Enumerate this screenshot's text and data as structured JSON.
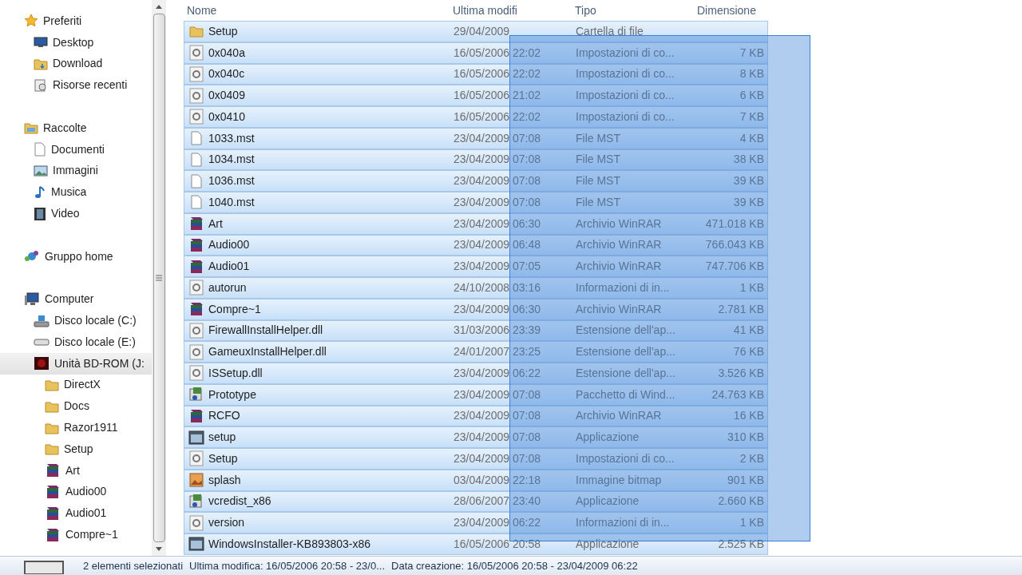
{
  "sidebar": {
    "groups": [
      {
        "label": "Preferiti",
        "kind": "star",
        "children": [
          {
            "label": "Desktop",
            "kind": "desktop",
            "selected": false
          },
          {
            "label": "Download",
            "kind": "download",
            "selected": false
          },
          {
            "label": "Risorse recenti",
            "kind": "recent",
            "selected": false
          }
        ]
      },
      {
        "label": "Raccolte",
        "kind": "library",
        "children": [
          {
            "label": "Documenti",
            "kind": "doc",
            "selected": false
          },
          {
            "label": "Immagini",
            "kind": "image",
            "selected": false
          },
          {
            "label": "Musica",
            "kind": "music",
            "selected": false
          },
          {
            "label": "Video",
            "kind": "video",
            "selected": false
          }
        ]
      },
      {
        "label": "Gruppo home",
        "kind": "homegroup"
      },
      {
        "label": "Computer",
        "kind": "computer",
        "children": [
          {
            "label": "Disco locale (C:)",
            "kind": "drivec",
            "selected": false
          },
          {
            "label": "Disco locale (E:)",
            "kind": "drive",
            "selected": false
          },
          {
            "label": "Unità BD-ROM (J:",
            "kind": "bdrom",
            "selected": true,
            "children": [
              {
                "label": "DirectX",
                "kind": "folder",
                "selected": false
              },
              {
                "label": "Docs",
                "kind": "folder",
                "selected": false
              },
              {
                "label": "Razor1911",
                "kind": "folder",
                "selected": false
              },
              {
                "label": "Setup",
                "kind": "folder",
                "selected": false
              },
              {
                "label": "Art",
                "kind": "rar",
                "selected": false
              },
              {
                "label": "Audio00",
                "kind": "rar",
                "selected": false
              },
              {
                "label": "Audio01",
                "kind": "rar",
                "selected": false
              },
              {
                "label": "Compre~1",
                "kind": "rar",
                "selected": false
              }
            ]
          }
        ]
      }
    ]
  },
  "table": {
    "columns": [
      "Nome",
      "Ultima modifi",
      "Tipo",
      "Dimensione"
    ],
    "rows": [
      {
        "kind": "folder",
        "name": "Setup",
        "date": "29/04/2009",
        "type": "Cartella di file",
        "size": "",
        "selected": true
      },
      {
        "kind": "settings",
        "name": "0x040a",
        "date": "16/05/2006 22:02",
        "type": "Impostazioni di co...",
        "size": "7 KB",
        "selected": true
      },
      {
        "kind": "settings",
        "name": "0x040c",
        "date": "16/05/2006 22:02",
        "type": "Impostazioni di co...",
        "size": "8 KB",
        "selected": true
      },
      {
        "kind": "settings",
        "name": "0x0409",
        "date": "16/05/2006 21:02",
        "type": "Impostazioni di co...",
        "size": "6 KB",
        "selected": true
      },
      {
        "kind": "settings",
        "name": "0x0410",
        "date": "16/05/2006 22:02",
        "type": "Impostazioni di co...",
        "size": "7 KB",
        "selected": true
      },
      {
        "kind": "file",
        "name": "1033.mst",
        "date": "23/04/2009 07:08",
        "type": "File MST",
        "size": "4 KB",
        "selected": true
      },
      {
        "kind": "file",
        "name": "1034.mst",
        "date": "23/04/2009 07:08",
        "type": "File MST",
        "size": "38 KB",
        "selected": true
      },
      {
        "kind": "file",
        "name": "1036.mst",
        "date": "23/04/2009 07:08",
        "type": "File MST",
        "size": "39 KB",
        "selected": true
      },
      {
        "kind": "file",
        "name": "1040.mst",
        "date": "23/04/2009 07:08",
        "type": "File MST",
        "size": "39 KB",
        "selected": true
      },
      {
        "kind": "rar",
        "name": "Art",
        "date": "23/04/2009 06:30",
        "type": "Archivio WinRAR",
        "size": "471.018 KB",
        "selected": true
      },
      {
        "kind": "rar",
        "name": "Audio00",
        "date": "23/04/2009 06:48",
        "type": "Archivio WinRAR",
        "size": "766.043 KB",
        "selected": true
      },
      {
        "kind": "rar",
        "name": "Audio01",
        "date": "23/04/2009 07:05",
        "type": "Archivio WinRAR",
        "size": "747.706 KB",
        "selected": true
      },
      {
        "kind": "settings",
        "name": "autorun",
        "date": "24/10/2008 03:16",
        "type": "Informazioni di in...",
        "size": "1 KB",
        "selected": true
      },
      {
        "kind": "rar",
        "name": "Compre~1",
        "date": "23/04/2009 06:30",
        "type": "Archivio WinRAR",
        "size": "2.781 KB",
        "selected": true
      },
      {
        "kind": "settings",
        "name": "FirewallInstallHelper.dll",
        "date": "31/03/2006 23:39",
        "type": "Estensione dell'ap...",
        "size": "41 KB",
        "selected": true
      },
      {
        "kind": "settings",
        "name": "GameuxInstallHelper.dll",
        "date": "24/01/2007 23:25",
        "type": "Estensione dell'ap...",
        "size": "76 KB",
        "selected": true
      },
      {
        "kind": "settings",
        "name": "ISSetup.dll",
        "date": "23/04/2009 06:22",
        "type": "Estensione dell'ap...",
        "size": "3.526 KB",
        "selected": true
      },
      {
        "kind": "installer",
        "name": "Prototype",
        "date": "23/04/2009 07:08",
        "type": "Pacchetto di Wind...",
        "size": "24.763 KB",
        "selected": true
      },
      {
        "kind": "rar",
        "name": "RCFO",
        "date": "23/04/2009 07:08",
        "type": "Archivio WinRAR",
        "size": "16 KB",
        "selected": true
      },
      {
        "kind": "app",
        "name": "setup",
        "date": "23/04/2009 07:08",
        "type": "Applicazione",
        "size": "310 KB",
        "selected": true
      },
      {
        "kind": "settings",
        "name": "Setup",
        "date": "23/04/2009 07:08",
        "type": "Impostazioni di co...",
        "size": "2 KB",
        "selected": true
      },
      {
        "kind": "bitmap",
        "name": "splash",
        "date": "03/04/2009 22:18",
        "type": "Immagine bitmap",
        "size": "901 KB",
        "selected": true
      },
      {
        "kind": "installer",
        "name": "vcredist_x86",
        "date": "28/06/2007 23:40",
        "type": "Applicazione",
        "size": "2.660 KB",
        "selected": true
      },
      {
        "kind": "settings",
        "name": "version",
        "date": "23/04/2009 06:22",
        "type": "Informazioni di in...",
        "size": "1 KB",
        "selected": true
      },
      {
        "kind": "app",
        "name": "WindowsInstaller-KB893803-x86",
        "date": "16/05/2006 20:58",
        "type": "Applicazione",
        "size": "2.525 KB",
        "selected": true
      }
    ]
  },
  "status_bar": {
    "count": "2 elementi selezionati",
    "modified": "Ultima modifica: 16/05/2006 20:58 - 23/0...",
    "created": "Data creazione: 16/05/2006 20:58 - 23/04/2009 06:22"
  }
}
